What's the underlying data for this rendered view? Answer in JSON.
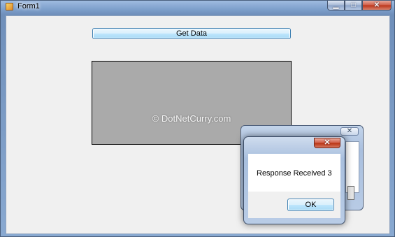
{
  "window": {
    "title": "Form1",
    "minimize_glyph": "▁",
    "maximize_glyph": "□",
    "close_glyph": "✕"
  },
  "form": {
    "get_data_label": "Get Data",
    "panel_color": "#aaaaaa",
    "watermark": "© DotNetCurry.com"
  },
  "background_dialog": {
    "close_glyph": "✕"
  },
  "message_box": {
    "close_glyph": "✕",
    "message": "Response  Received 3",
    "ok_label": "OK"
  },
  "colors": {
    "accent": "#3c7fb1",
    "close_red": "#c8452c"
  }
}
